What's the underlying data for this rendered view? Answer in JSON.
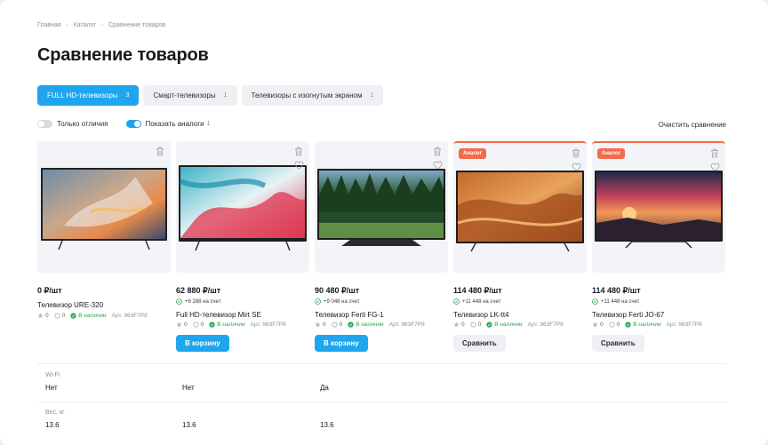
{
  "breadcrumb": [
    "Главная",
    "Каталог",
    "Сравнение товаров"
  ],
  "title": "Сравнение товаров",
  "tabs": [
    {
      "label": "FULL HD-телевизоры",
      "count": "3",
      "active": true
    },
    {
      "label": "Смарт-телевизоры",
      "count": "1",
      "active": false
    },
    {
      "label": "Телевизоры с изогнутым экраном",
      "count": "1",
      "active": false
    }
  ],
  "toggles": {
    "only_diff": {
      "label": "Только отличия",
      "on": false
    },
    "show_analogs": {
      "label": "Показать аналоги",
      "count": "1",
      "on": true
    }
  },
  "clear_label": "Очистить сравнение",
  "products": [
    {
      "price": "0 ₽/шт",
      "bonus": "",
      "name": "Телевизор URE-320",
      "rating": "0",
      "reviews": "0",
      "stock": "В наличии",
      "art": "Арт. 963F7P8",
      "badge": "",
      "button": "",
      "image": "tv-abstract"
    },
    {
      "price": "62 880 ₽/шт",
      "bonus": "+6 288 на счет",
      "name": "Full HD-телевизор Mirt SE",
      "rating": "0",
      "reviews": "0",
      "stock": "В наличии",
      "art": "Арт. 963F7P8",
      "badge": "",
      "button": "В корзину",
      "image": "tv-ink"
    },
    {
      "price": "90 480 ₽/шт",
      "bonus": "+9 048 на счет",
      "name": "Телевизор Ferti FG-1",
      "rating": "0",
      "reviews": "0",
      "stock": "В наличии",
      "art": "Арт. 963F7P8",
      "badge": "",
      "button": "В корзину",
      "image": "tv-forest"
    },
    {
      "price": "114 480 ₽/шт",
      "bonus": "+11 448 на счет",
      "name": "Телевизор LK-tt4",
      "rating": "0",
      "reviews": "0",
      "stock": "В наличии",
      "art": "Арт. 963F7P8",
      "badge": "Аналог",
      "button": "Сравнить",
      "image": "tv-desert"
    },
    {
      "price": "114 480 ₽/шт",
      "bonus": "+11 448 на счет",
      "name": "Телевизор Ferti JO-67",
      "rating": "0",
      "reviews": "0",
      "stock": "В наличии",
      "art": "Арт. 963F7P8",
      "badge": "Аналог",
      "button": "Сравнить",
      "image": "tv-sunset"
    }
  ],
  "specs": [
    {
      "label": "Wi-Fi",
      "values": [
        "Нет",
        "Нет",
        "Да"
      ]
    },
    {
      "label": "Вес, кг",
      "values": [
        "13.6",
        "13.6",
        "13.6"
      ]
    }
  ],
  "colors": {
    "accent": "#1ea5ee",
    "analog": "#f26b4d",
    "stock": "#2aa852"
  },
  "icons": [
    "trash-icon",
    "heart-icon",
    "star-icon",
    "comment-icon",
    "check-circle-icon",
    "bonus-icon",
    "breadcrumb-separator-icon"
  ]
}
